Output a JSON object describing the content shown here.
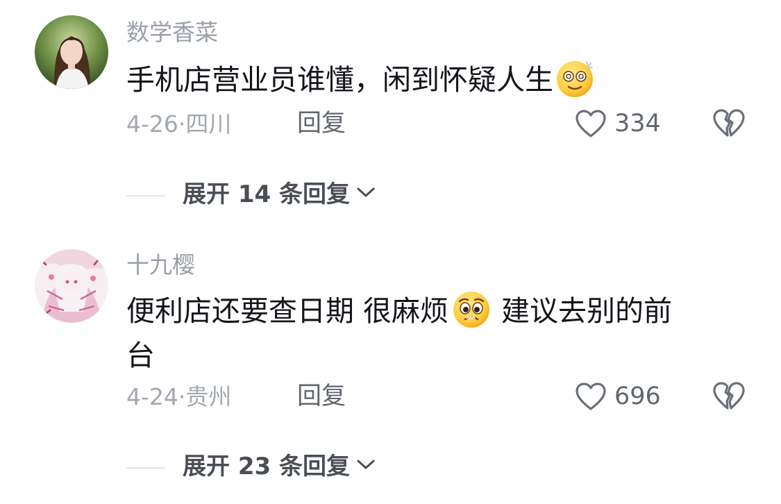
{
  "comments": [
    {
      "username": "数学香菜",
      "text": "手机店营业员谁懂，闲到怀疑人生",
      "emoji": "face-with-spiral-eyes-emoji",
      "date": "4-26",
      "location": "四川",
      "reply_label": "回复",
      "like_count": "334",
      "expand_label": "展开 14 条回复"
    },
    {
      "username": "十九樱",
      "text_part1": "便利店还要查日期 很麻烦",
      "emoji": "pleading-face-emoji",
      "text_part2": "建议去别的前",
      "text_line2": "台",
      "date": "4-24",
      "location": "贵州",
      "reply_label": "回复",
      "like_count": "696",
      "expand_label": "展开 23 条回复"
    }
  ],
  "meta_separator": "·",
  "icons": {
    "like": "heart-outline-icon",
    "dislike": "broken-heart-icon",
    "expand": "chevron-down-icon"
  },
  "colors": {
    "username": "#9aa0a8",
    "text": "#15161b",
    "meta": "#a3a8af",
    "action": "#61666e"
  }
}
